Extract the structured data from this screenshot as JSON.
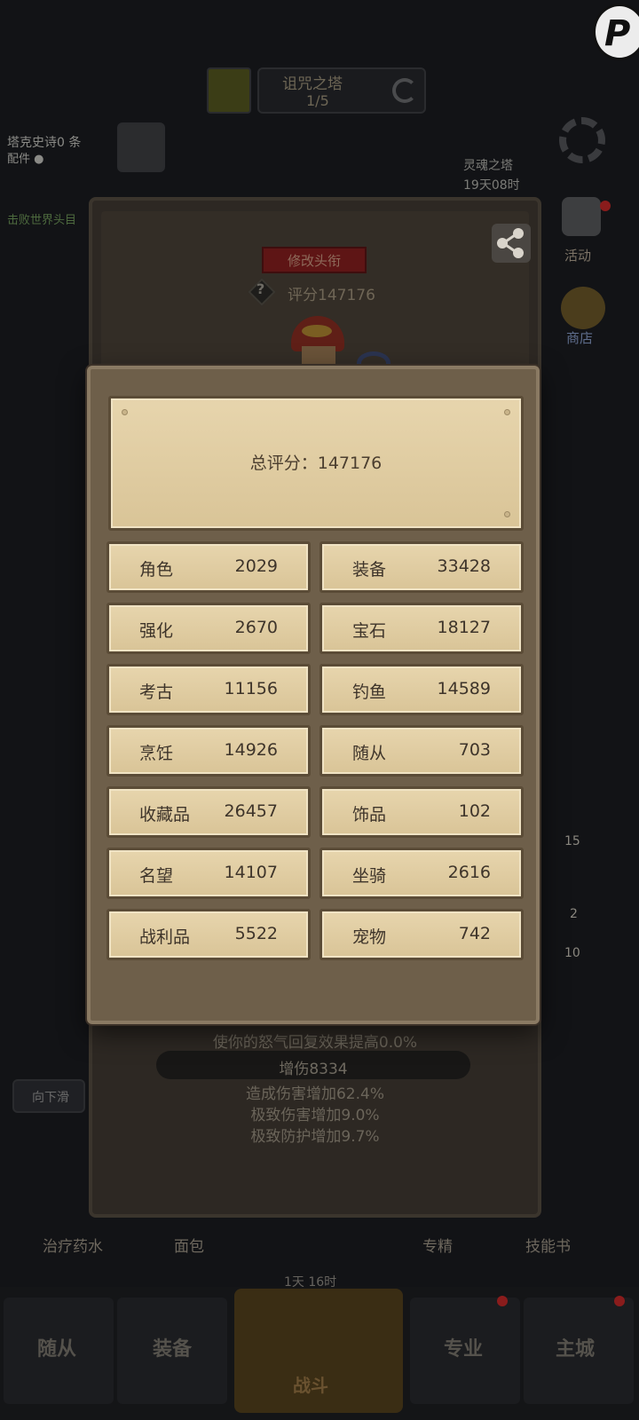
{
  "background": {
    "top": {
      "title": "诅咒之塔",
      "count": "1/5"
    },
    "left": {
      "name": "塔克史诗0 条",
      "status": "配件 ●",
      "info": "击败世界头目"
    },
    "right": {
      "mode": "灵魂之塔",
      "timer": "19天08时",
      "activity_label": "活动",
      "shop_label": "商店"
    },
    "side_numbers": [
      "15",
      "2",
      "10"
    ],
    "ghost_button": "向下滑",
    "bottom_items": [
      {
        "label": "治疗药水"
      },
      {
        "label": "面包"
      },
      {
        "label": "专精"
      },
      {
        "label": "技能书"
      }
    ],
    "small_timer": "1天 16时",
    "nav": {
      "left1": "随从",
      "left2": "装备",
      "center": "战斗",
      "right1": "专业",
      "right2": "主城"
    }
  },
  "profile": {
    "edit_title_button": "修改头衔",
    "help_icon": "?",
    "score_text": "评分147176",
    "stats": [
      "使你的怒气回复效果提高0.0%",
      "造成伤害增加62.4%",
      "极致伤害增加9.0%",
      "极致防护增加9.7%"
    ],
    "damage_pill": "增伤8334"
  },
  "dialog": {
    "total_label": "总评分：147176",
    "rows": [
      [
        {
          "name": "角色",
          "value": "2029"
        },
        {
          "name": "装备",
          "value": "33428"
        }
      ],
      [
        {
          "name": "强化",
          "value": "2670"
        },
        {
          "name": "宝石",
          "value": "18127"
        }
      ],
      [
        {
          "name": "考古",
          "value": "11156"
        },
        {
          "name": "钓鱼",
          "value": "14589"
        }
      ],
      [
        {
          "name": "烹饪",
          "value": "14926"
        },
        {
          "name": "随从",
          "value": "703"
        }
      ],
      [
        {
          "name": "收藏品",
          "value": "26457"
        },
        {
          "name": "饰品",
          "value": "102"
        }
      ],
      [
        {
          "name": "名望",
          "value": "14107"
        },
        {
          "name": "坐骑",
          "value": "2616"
        }
      ],
      [
        {
          "name": "战利品",
          "value": "5522"
        },
        {
          "name": "宠物",
          "value": "742"
        }
      ]
    ]
  },
  "colors": {
    "parchment": "#e7d5ad",
    "dialog_frame": "#6e5f4a",
    "edit_button": "#5e1515"
  }
}
